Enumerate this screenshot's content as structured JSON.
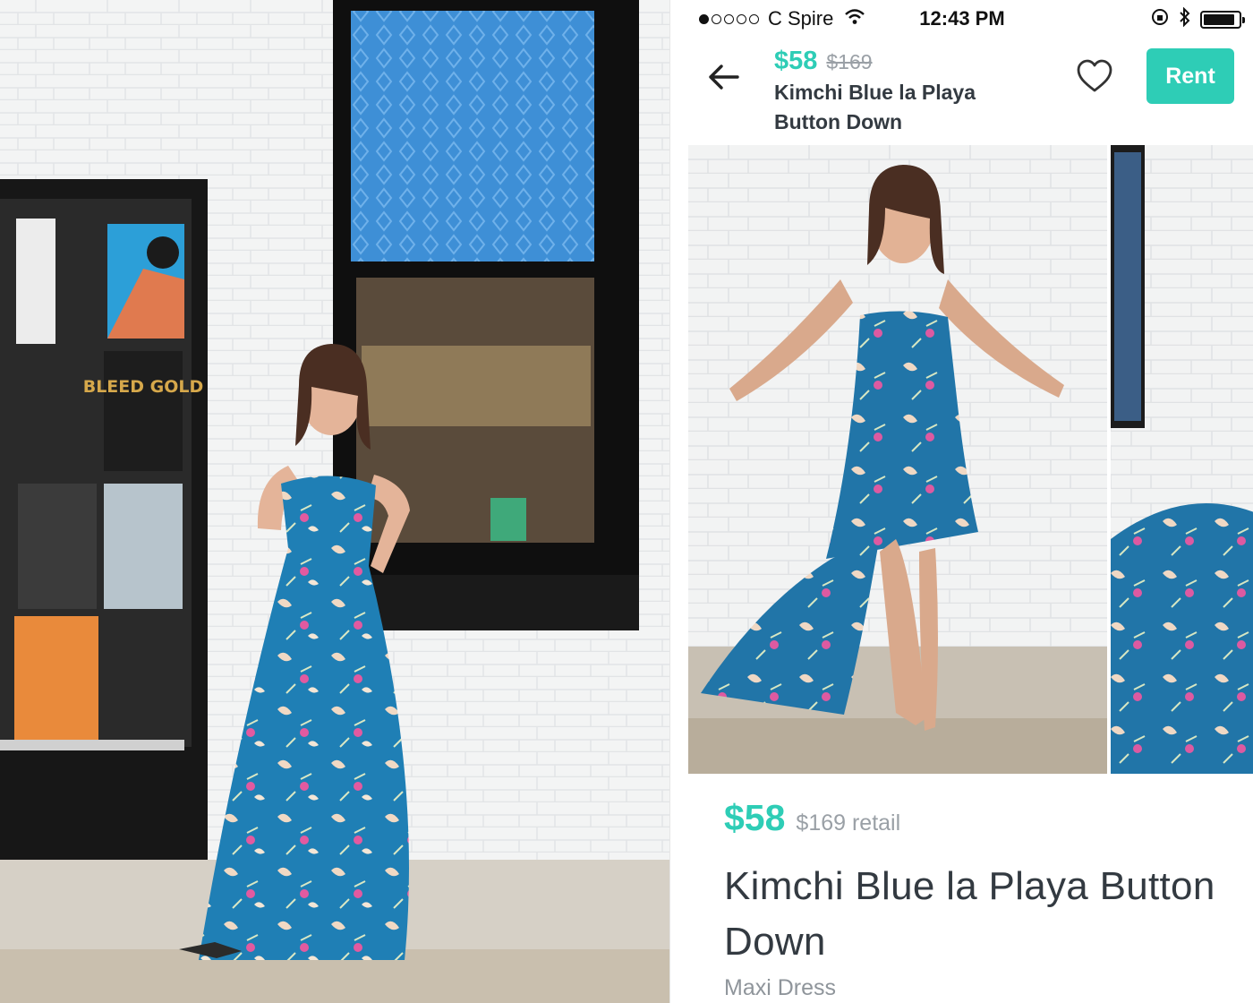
{
  "status_bar": {
    "carrier": "C Spire",
    "signal_dots_filled": 1,
    "signal_dots_total": 5,
    "time": "12:43 PM",
    "battery_level": 0.9,
    "icons": [
      "signal-dots-icon",
      "wifi-icon",
      "rotation-lock-icon",
      "bluetooth-icon",
      "battery-icon"
    ]
  },
  "nav": {
    "price": "$58",
    "retail_price": "$169",
    "title": "Kimchi Blue la Playa Button Down",
    "back_icon": "back-arrow-icon",
    "favorite_icon": "heart-outline-icon",
    "rent_label": "Rent",
    "accent_color": "#2ecdb6"
  },
  "carousel": {
    "images": [
      "dress-photo-wall-pose",
      "dress-photo-twirl"
    ]
  },
  "product": {
    "price": "$58",
    "retail_label": "$169 retail",
    "title": "Kimchi Blue la Playa Button Down",
    "category": "Maxi Dress"
  },
  "left_photo": {
    "poster_texts": [
      "BLEED GOLD"
    ]
  }
}
